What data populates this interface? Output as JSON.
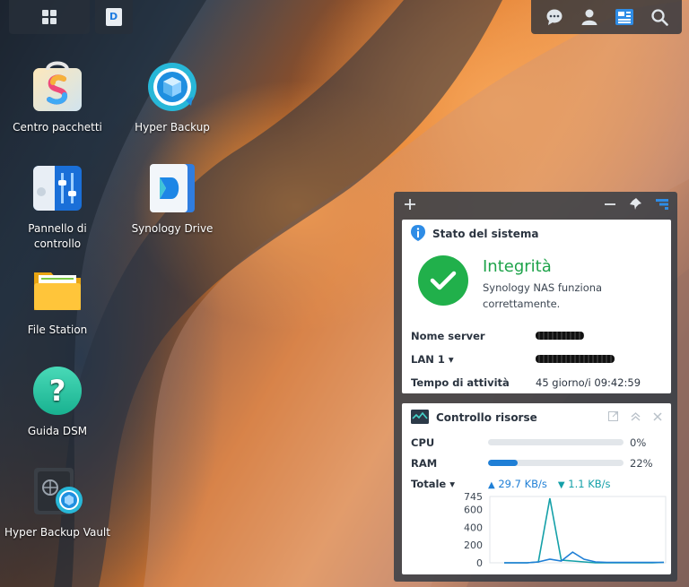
{
  "desktop": {
    "icons": [
      {
        "label": "Centro pacchetti",
        "icon": "package-center-icon"
      },
      {
        "label": "Hyper Backup",
        "icon": "hyper-backup-icon"
      },
      {
        "label": "Pannello di controllo",
        "icon": "control-panel-icon"
      },
      {
        "label": "Synology Drive",
        "icon": "synology-drive-icon"
      },
      {
        "label": "File Station",
        "icon": "file-station-icon"
      },
      {
        "label": "Guida DSM",
        "icon": "help-icon"
      },
      {
        "label": "Hyper Backup Vault",
        "icon": "hyper-backup-vault-icon"
      }
    ]
  },
  "topbar": {
    "left": [
      {
        "icon": "main-menu-icon"
      },
      {
        "icon": "synology-drive-task-icon"
      }
    ],
    "right": [
      {
        "icon": "chat-icon"
      },
      {
        "icon": "user-icon"
      },
      {
        "icon": "widgets-icon"
      },
      {
        "icon": "search-icon"
      }
    ]
  },
  "widgets": {
    "system": {
      "title": "Stato del sistema",
      "status_title": "Integrità",
      "status_desc_1": "Synology NAS funziona",
      "status_desc_2": "correttamente.",
      "rows": [
        {
          "key": "Nome server",
          "value": ""
        },
        {
          "key": "LAN 1 ▾",
          "value": ""
        },
        {
          "key": "Tempo di attività",
          "value": "45 giorno/i 09:42:59"
        }
      ]
    },
    "resources": {
      "title": "Controllo risorse",
      "cpu_label": "CPU",
      "cpu_percent": 0,
      "cpu_text": "0%",
      "ram_label": "RAM",
      "ram_percent": 22,
      "ram_text": "22%",
      "total_label": "Totale ▾",
      "upload": "29.7 KB/s",
      "download": "1.1 KB/s"
    }
  },
  "colors": {
    "accent": "#1f7fd6",
    "ok": "#21b04b",
    "teal": "#14a0a8"
  },
  "chart_data": {
    "type": "line",
    "y_ticks": [
      "745",
      "600",
      "400",
      "200",
      "0"
    ],
    "ylim": [
      0,
      745
    ],
    "series": [
      {
        "values": [
          0,
          0,
          0,
          10,
          725,
          30,
          20,
          10,
          0,
          0,
          0,
          0,
          0,
          0,
          5
        ]
      },
      {
        "values": [
          0,
          0,
          0,
          10,
          40,
          20,
          120,
          40,
          10,
          5,
          5,
          5,
          5,
          5,
          5
        ]
      }
    ]
  }
}
